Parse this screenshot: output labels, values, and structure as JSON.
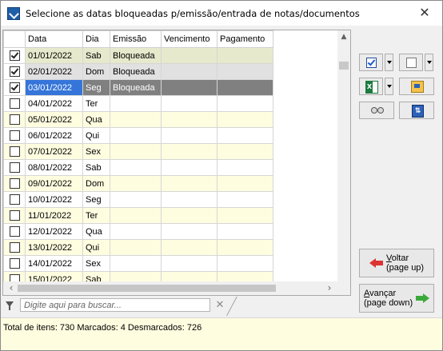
{
  "window": {
    "title": "Selecione as datas bloqueadas p/emissão/entrada de notas/documentos",
    "close_glyph": "✕",
    "icon": "app-icon"
  },
  "grid": {
    "columns": [
      "",
      "Data",
      "Dia",
      "Emissão",
      "Vencimento",
      "Pagamento"
    ],
    "rows": [
      {
        "checked": true,
        "date": "01/01/2022",
        "day": "Sab",
        "emissao": "Bloqueada",
        "vencimento": "",
        "pagamento": "",
        "state": "selected-checked"
      },
      {
        "checked": true,
        "date": "02/01/2022",
        "day": "Dom",
        "emissao": "Bloqueada",
        "vencimento": "",
        "pagamento": "",
        "state": "selected-checked-alt"
      },
      {
        "checked": true,
        "date": "03/01/2022",
        "day": "Seg",
        "emissao": "Bloqueada",
        "vencimento": "",
        "pagamento": "",
        "state": "current"
      },
      {
        "checked": false,
        "date": "04/01/2022",
        "day": "Ter",
        "emissao": "",
        "vencimento": "",
        "pagamento": "",
        "state": "normal"
      },
      {
        "checked": false,
        "date": "05/01/2022",
        "day": "Qua",
        "emissao": "",
        "vencimento": "",
        "pagamento": "",
        "state": "alt"
      },
      {
        "checked": false,
        "date": "06/01/2022",
        "day": "Qui",
        "emissao": "",
        "vencimento": "",
        "pagamento": "",
        "state": "normal"
      },
      {
        "checked": false,
        "date": "07/01/2022",
        "day": "Sex",
        "emissao": "",
        "vencimento": "",
        "pagamento": "",
        "state": "alt"
      },
      {
        "checked": false,
        "date": "08/01/2022",
        "day": "Sab",
        "emissao": "",
        "vencimento": "",
        "pagamento": "",
        "state": "normal"
      },
      {
        "checked": false,
        "date": "09/01/2022",
        "day": "Dom",
        "emissao": "",
        "vencimento": "",
        "pagamento": "",
        "state": "alt"
      },
      {
        "checked": false,
        "date": "10/01/2022",
        "day": "Seg",
        "emissao": "",
        "vencimento": "",
        "pagamento": "",
        "state": "normal"
      },
      {
        "checked": false,
        "date": "11/01/2022",
        "day": "Ter",
        "emissao": "",
        "vencimento": "",
        "pagamento": "",
        "state": "alt"
      },
      {
        "checked": false,
        "date": "12/01/2022",
        "day": "Qua",
        "emissao": "",
        "vencimento": "",
        "pagamento": "",
        "state": "normal"
      },
      {
        "checked": false,
        "date": "13/01/2022",
        "day": "Qui",
        "emissao": "",
        "vencimento": "",
        "pagamento": "",
        "state": "alt"
      },
      {
        "checked": false,
        "date": "14/01/2022",
        "day": "Sex",
        "emissao": "",
        "vencimento": "",
        "pagamento": "",
        "state": "normal"
      },
      {
        "checked": false,
        "date": "15/01/2022",
        "day": "Sab",
        "emissao": "",
        "vencimento": "",
        "pagamento": "",
        "state": "alt"
      }
    ]
  },
  "search": {
    "placeholder": "Digite aqui para buscar...",
    "clear_glyph": "✕"
  },
  "toolbar": {
    "buttons": [
      "check-all-icon",
      "uncheck-all-icon",
      "excel-export-icon",
      "report-icon",
      "binoculars-icon",
      "sort-icon"
    ],
    "sort_glyph": "⇅"
  },
  "nav": {
    "back_label_underlined": "V",
    "back_label_rest": "oltar",
    "back_label_line2": "(page up)",
    "forward_label_underlined": "A",
    "forward_label_rest": "vançar",
    "forward_label_line2": "(page down)"
  },
  "status": {
    "text": "Total de itens: 730 Marcados: 4 Desmarcados: 726"
  }
}
